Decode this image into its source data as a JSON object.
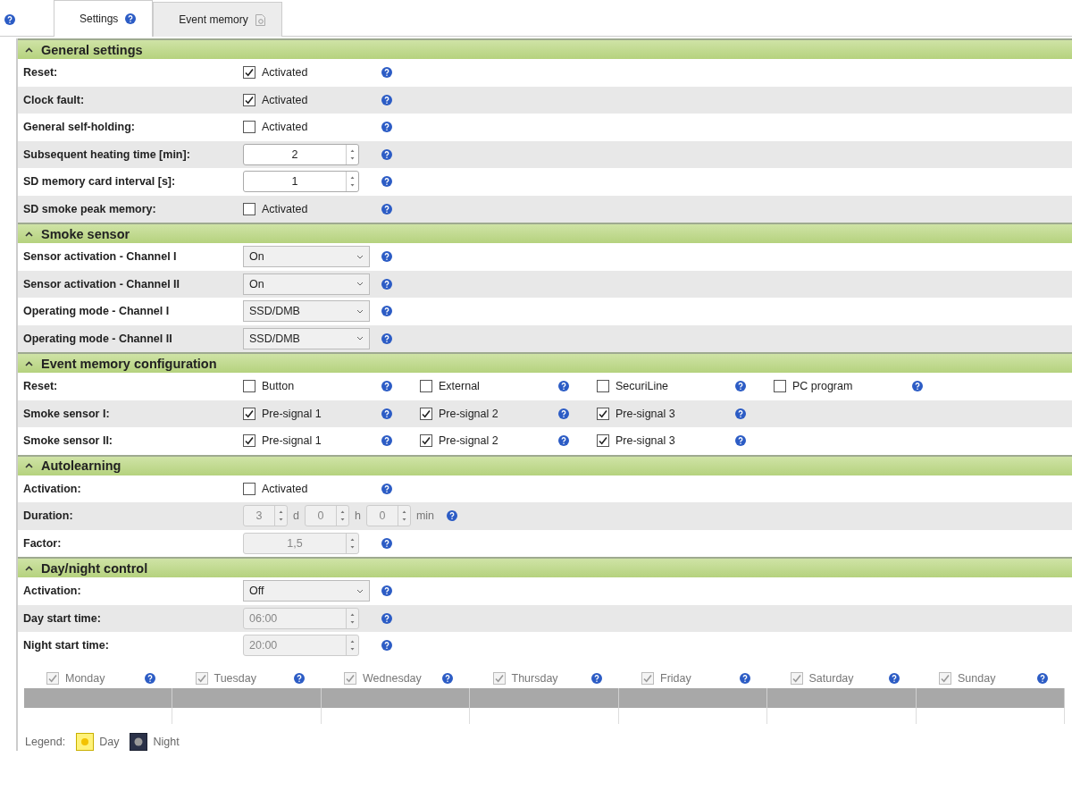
{
  "tabs": [
    {
      "label": "Settings",
      "selected": true
    },
    {
      "label": "Event memory",
      "selected": false
    }
  ],
  "sections": [
    {
      "title": "General settings",
      "expanded": true,
      "rows": [
        {
          "label": "Reset:",
          "controls": [
            {
              "kind": "checkbox",
              "label": "Activated",
              "checked": true,
              "disabled": false
            }
          ]
        },
        {
          "label": "Clock fault:",
          "controls": [
            {
              "kind": "checkbox",
              "label": "Activated",
              "checked": true,
              "disabled": false
            }
          ]
        },
        {
          "label": "General self-holding:",
          "controls": [
            {
              "kind": "checkbox",
              "label": "Activated",
              "checked": false,
              "disabled": false
            }
          ]
        },
        {
          "label": "Subsequent heating time [min]:",
          "controls": [
            {
              "kind": "spinner",
              "value": "2",
              "disabled": false
            }
          ]
        },
        {
          "label": "SD memory card interval [s]:",
          "controls": [
            {
              "kind": "spinner",
              "value": "1",
              "disabled": false
            }
          ]
        },
        {
          "label": "SD smoke peak memory:",
          "controls": [
            {
              "kind": "checkbox",
              "label": "Activated",
              "checked": false,
              "disabled": false
            }
          ]
        }
      ]
    },
    {
      "title": "Smoke sensor",
      "expanded": true,
      "rows": [
        {
          "label": "Sensor activation - Channel I",
          "controls": [
            {
              "kind": "select",
              "value": "On"
            }
          ]
        },
        {
          "label": "Sensor activation - Channel II",
          "controls": [
            {
              "kind": "select",
              "value": "On"
            }
          ]
        },
        {
          "label": "Operating mode - Channel I",
          "controls": [
            {
              "kind": "select",
              "value": "SSD/DMB"
            }
          ]
        },
        {
          "label": "Operating mode - Channel II",
          "controls": [
            {
              "kind": "select",
              "value": "SSD/DMB"
            }
          ]
        }
      ]
    },
    {
      "title": "Event memory configuration",
      "expanded": true,
      "rows": [
        {
          "label": "Reset:",
          "controls": [
            {
              "kind": "checkbox",
              "label": "Button",
              "checked": false,
              "disabled": false
            },
            {
              "kind": "checkbox",
              "label": "External",
              "checked": false,
              "disabled": false
            },
            {
              "kind": "checkbox",
              "label": "SecuriLine",
              "checked": false,
              "disabled": false
            },
            {
              "kind": "checkbox",
              "label": "PC program",
              "checked": false,
              "disabled": false
            }
          ]
        },
        {
          "label": "Smoke sensor I:",
          "controls": [
            {
              "kind": "checkbox",
              "label": "Pre-signal 1",
              "checked": true,
              "disabled": false
            },
            {
              "kind": "checkbox",
              "label": "Pre-signal 2",
              "checked": true,
              "disabled": false
            },
            {
              "kind": "checkbox",
              "label": "Pre-signal 3",
              "checked": true,
              "disabled": false
            }
          ]
        },
        {
          "label": "Smoke sensor II:",
          "controls": [
            {
              "kind": "checkbox",
              "label": "Pre-signal 1",
              "checked": true,
              "disabled": false
            },
            {
              "kind": "checkbox",
              "label": "Pre-signal 2",
              "checked": true,
              "disabled": false
            },
            {
              "kind": "checkbox",
              "label": "Pre-signal 3",
              "checked": true,
              "disabled": false
            }
          ]
        }
      ]
    },
    {
      "title": "Autolearning",
      "expanded": true,
      "rows": [
        {
          "label": "Activation:",
          "controls": [
            {
              "kind": "checkbox",
              "label": "Activated",
              "checked": false,
              "disabled": false
            }
          ]
        },
        {
          "label": "Duration:",
          "controls": [
            {
              "kind": "duration",
              "disabled": true,
              "parts": [
                {
                  "value": "3",
                  "unit": "d"
                },
                {
                  "value": "0",
                  "unit": "h"
                },
                {
                  "value": "0",
                  "unit": "min"
                }
              ]
            }
          ]
        },
        {
          "label": "Factor:",
          "controls": [
            {
              "kind": "spinner",
              "value": "1,5",
              "disabled": true
            }
          ]
        }
      ]
    },
    {
      "title": "Day/night control",
      "expanded": true,
      "rows": [
        {
          "label": "Activation:",
          "controls": [
            {
              "kind": "select",
              "value": "Off"
            }
          ]
        },
        {
          "label": "Day start time:",
          "controls": [
            {
              "kind": "time",
              "value": "06:00",
              "disabled": true
            }
          ]
        },
        {
          "label": "Night start time:",
          "controls": [
            {
              "kind": "time",
              "value": "20:00",
              "disabled": true
            }
          ]
        }
      ],
      "days": [
        {
          "label": "Monday",
          "checked": true,
          "disabled": true
        },
        {
          "label": "Tuesday",
          "checked": true,
          "disabled": true
        },
        {
          "label": "Wednesday",
          "checked": true,
          "disabled": true
        },
        {
          "label": "Thursday",
          "checked": true,
          "disabled": true
        },
        {
          "label": "Friday",
          "checked": true,
          "disabled": true
        },
        {
          "label": "Saturday",
          "checked": true,
          "disabled": true
        },
        {
          "label": "Sunday",
          "checked": true,
          "disabled": true
        }
      ],
      "legend": {
        "label": "Legend:",
        "items": [
          {
            "kind": "day",
            "label": "Day"
          },
          {
            "kind": "night",
            "label": "Night"
          }
        ]
      }
    }
  ]
}
